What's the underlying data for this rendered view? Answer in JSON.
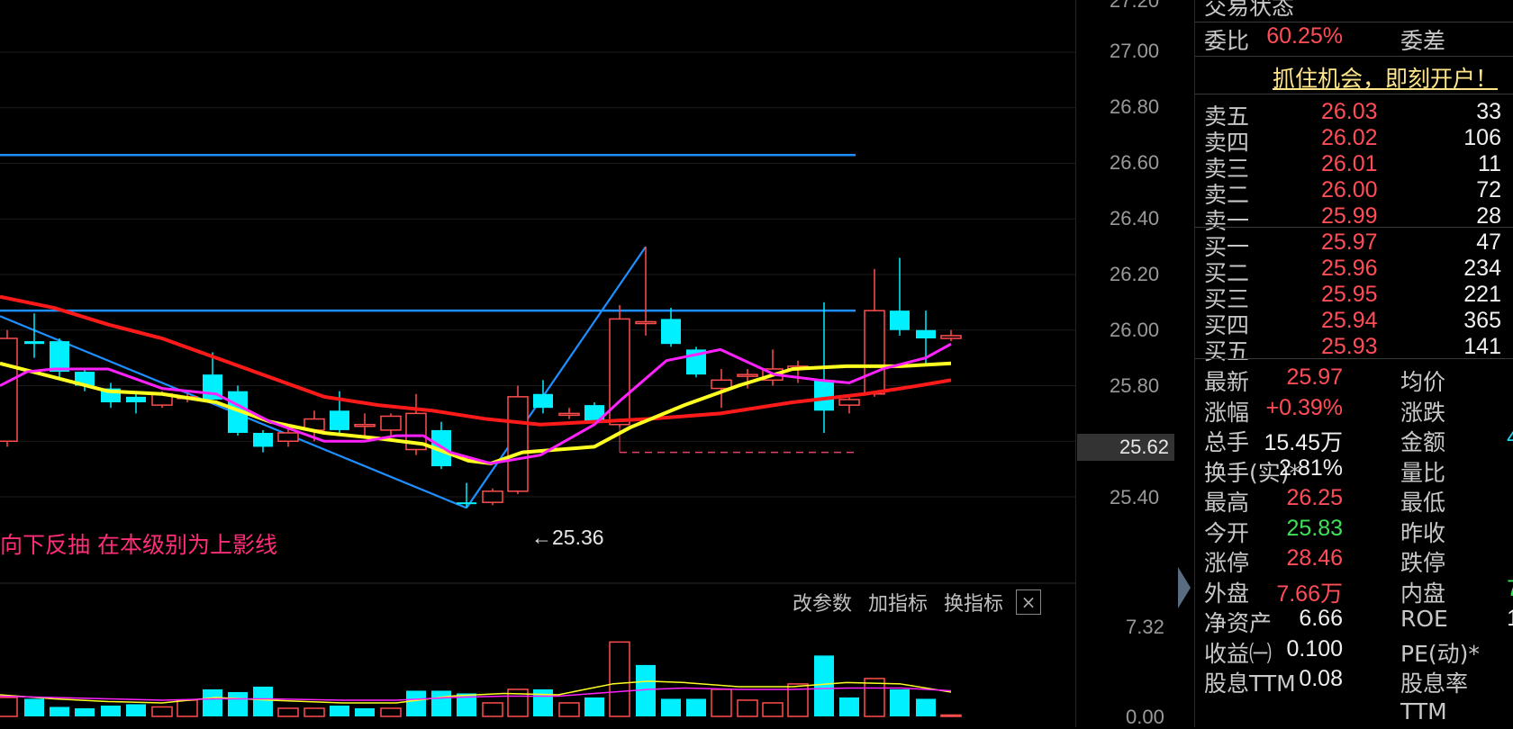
{
  "price_axis": {
    "ticks": [
      "27.00",
      "26.80",
      "26.60",
      "26.40",
      "26.20",
      "26.00",
      "25.80",
      "25.60",
      "25.40"
    ],
    "current_price": "25.62",
    "top_partial": "27.20"
  },
  "annotations": {
    "low_label": "←25.36",
    "note": "向下反抽 在本级别为上影线"
  },
  "toolbar": {
    "modify_params": "改参数",
    "add_indicator": "加指标",
    "change_indicator": "换指标",
    "close": "×"
  },
  "volume_axis": {
    "top": "7.32",
    "bottom": "0.00"
  },
  "panel": {
    "status_header": "交易状态",
    "weibi_label": "委比",
    "weibi_value": "60.25%",
    "weicha_label": "委差",
    "promo": "抓住机会，即刻开户！",
    "sell": [
      {
        "label": "卖五",
        "price": "26.03",
        "qty": "33"
      },
      {
        "label": "卖四",
        "price": "26.02",
        "qty": "106"
      },
      {
        "label": "卖三",
        "price": "26.01",
        "qty": "11"
      },
      {
        "label": "卖二",
        "price": "26.00",
        "qty": "72"
      },
      {
        "label": "卖一",
        "price": "25.99",
        "qty": "28"
      }
    ],
    "buy": [
      {
        "label": "买一",
        "price": "25.97",
        "qty": "47"
      },
      {
        "label": "买二",
        "price": "25.96",
        "qty": "234"
      },
      {
        "label": "买三",
        "price": "25.95",
        "qty": "221"
      },
      {
        "label": "买四",
        "price": "25.94",
        "qty": "365"
      },
      {
        "label": "买五",
        "price": "25.93",
        "qty": "141"
      }
    ],
    "stats": [
      {
        "l1": "最新",
        "v1": "25.97",
        "c1": "red",
        "l2": "均价"
      },
      {
        "l1": "涨幅",
        "v1": "+0.39%",
        "c1": "red",
        "l2": "涨跌"
      },
      {
        "l1": "总手",
        "v1": "15.45万",
        "c1": "white",
        "l2": "金额",
        "v2": "4",
        "c2": "cyan"
      },
      {
        "l1": "换手(实)*",
        "v1": "2.81%",
        "c1": "white",
        "l2": "量比"
      },
      {
        "l1": "最高",
        "v1": "26.25",
        "c1": "red",
        "l2": "最低"
      },
      {
        "l1": "今开",
        "v1": "25.83",
        "c1": "green",
        "l2": "昨收"
      },
      {
        "l1": "涨停",
        "v1": "28.46",
        "c1": "red",
        "l2": "跌停"
      },
      {
        "l1": "外盘",
        "v1": "7.66万",
        "c1": "red",
        "l2": "内盘",
        "v2": "7",
        "c2": "green"
      },
      {
        "l1": "净资产",
        "v1": "6.66",
        "c1": "white",
        "l2": "ROE",
        "v2": "1",
        "c2": "white"
      },
      {
        "l1": "收益㈠",
        "v1": "0.100",
        "c1": "white",
        "l2": "PE(动)*",
        "v2": "(",
        "c2": "white"
      },
      {
        "l1": "股息TTM",
        "v1": "0.08",
        "c1": "white",
        "l2": "股息率TTM"
      }
    ]
  },
  "chart_data": {
    "type": "candlestick",
    "y_range": [
      25.25,
      27.25
    ],
    "low_marker": 25.36,
    "hlines": [
      26.63,
      26.07
    ],
    "candles": [
      {
        "x": 8,
        "o": 25.6,
        "c": 25.97,
        "h": 26.0,
        "l": 25.58,
        "up": true
      },
      {
        "x": 38,
        "o": 25.96,
        "c": 25.95,
        "h": 26.06,
        "l": 25.9,
        "up": false
      },
      {
        "x": 66,
        "o": 25.96,
        "c": 25.85,
        "h": 25.97,
        "l": 25.82,
        "up": false
      },
      {
        "x": 94,
        "o": 25.85,
        "c": 25.8,
        "h": 25.86,
        "l": 25.78,
        "up": false
      },
      {
        "x": 123,
        "o": 25.79,
        "c": 25.74,
        "h": 25.81,
        "l": 25.72,
        "up": false
      },
      {
        "x": 151,
        "o": 25.76,
        "c": 25.74,
        "h": 25.77,
        "l": 25.7,
        "up": false
      },
      {
        "x": 180,
        "o": 25.73,
        "c": 25.77,
        "h": 25.78,
        "l": 25.72,
        "up": true
      },
      {
        "x": 208,
        "o": 25.76,
        "c": 25.76,
        "h": 25.77,
        "l": 25.74,
        "up": true
      },
      {
        "x": 236,
        "o": 25.84,
        "c": 25.75,
        "h": 25.92,
        "l": 25.75,
        "up": false
      },
      {
        "x": 264,
        "o": 25.78,
        "c": 25.63,
        "h": 25.8,
        "l": 25.62,
        "up": false
      },
      {
        "x": 292,
        "o": 25.63,
        "c": 25.58,
        "h": 25.64,
        "l": 25.56,
        "up": false
      },
      {
        "x": 320,
        "o": 25.6,
        "c": 25.63,
        "h": 25.66,
        "l": 25.58,
        "up": true
      },
      {
        "x": 349,
        "o": 25.64,
        "c": 25.68,
        "h": 25.71,
        "l": 25.6,
        "up": true
      },
      {
        "x": 377,
        "o": 25.71,
        "c": 25.64,
        "h": 25.78,
        "l": 25.63,
        "up": false
      },
      {
        "x": 405,
        "o": 25.66,
        "c": 25.66,
        "h": 25.7,
        "l": 25.62,
        "up": true
      },
      {
        "x": 434,
        "o": 25.64,
        "c": 25.69,
        "h": 25.7,
        "l": 25.62,
        "up": true
      },
      {
        "x": 462,
        "o": 25.57,
        "c": 25.7,
        "h": 25.77,
        "l": 25.55,
        "up": true
      },
      {
        "x": 490,
        "o": 25.64,
        "c": 25.51,
        "h": 25.67,
        "l": 25.5,
        "up": false
      },
      {
        "x": 518,
        "o": 25.38,
        "c": 25.38,
        "h": 25.45,
        "l": 25.36,
        "up": false
      },
      {
        "x": 547,
        "o": 25.38,
        "c": 25.42,
        "h": 25.43,
        "l": 25.37,
        "up": true
      },
      {
        "x": 575,
        "o": 25.42,
        "c": 25.76,
        "h": 25.8,
        "l": 25.41,
        "up": true
      },
      {
        "x": 603,
        "o": 25.77,
        "c": 25.72,
        "h": 25.82,
        "l": 25.7,
        "up": false
      },
      {
        "x": 632,
        "o": 25.7,
        "c": 25.7,
        "h": 25.72,
        "l": 25.68,
        "up": true
      },
      {
        "x": 660,
        "o": 25.73,
        "c": 25.67,
        "h": 25.74,
        "l": 25.66,
        "up": false
      },
      {
        "x": 688,
        "o": 25.66,
        "c": 26.04,
        "h": 26.09,
        "l": 25.65,
        "up": true
      },
      {
        "x": 717,
        "o": 26.03,
        "c": 26.03,
        "h": 26.3,
        "l": 25.98,
        "up": true
      },
      {
        "x": 745,
        "o": 26.04,
        "c": 25.95,
        "h": 26.08,
        "l": 25.94,
        "up": false
      },
      {
        "x": 773,
        "o": 25.93,
        "c": 25.84,
        "h": 25.94,
        "l": 25.83,
        "up": false
      },
      {
        "x": 801,
        "o": 25.79,
        "c": 25.82,
        "h": 25.86,
        "l": 25.72,
        "up": true
      },
      {
        "x": 830,
        "o": 25.84,
        "c": 25.84,
        "h": 25.86,
        "l": 25.79,
        "up": true
      },
      {
        "x": 858,
        "o": 25.82,
        "c": 25.86,
        "h": 25.93,
        "l": 25.8,
        "up": true
      },
      {
        "x": 886,
        "o": 25.86,
        "c": 25.87,
        "h": 25.89,
        "l": 25.81,
        "up": true
      },
      {
        "x": 915,
        "o": 25.82,
        "c": 25.71,
        "h": 26.1,
        "l": 25.63,
        "up": false
      },
      {
        "x": 943,
        "o": 25.73,
        "c": 25.75,
        "h": 25.76,
        "l": 25.7,
        "up": true
      },
      {
        "x": 971,
        "o": 25.77,
        "c": 26.07,
        "h": 26.22,
        "l": 25.76,
        "up": true
      },
      {
        "x": 999,
        "o": 26.07,
        "c": 26.0,
        "h": 26.26,
        "l": 25.98,
        "up": false
      },
      {
        "x": 1028,
        "o": 26.0,
        "c": 25.97,
        "h": 26.07,
        "l": 25.87,
        "up": false
      },
      {
        "x": 1056,
        "o": 25.97,
        "c": 25.98,
        "h": 26.0,
        "l": 25.96,
        "up": true
      }
    ],
    "ma_yellow": [
      [
        0,
        25.88
      ],
      [
        60,
        25.83
      ],
      [
        120,
        25.78
      ],
      [
        180,
        25.77
      ],
      [
        240,
        25.74
      ],
      [
        300,
        25.67
      ],
      [
        360,
        25.63
      ],
      [
        420,
        25.61
      ],
      [
        470,
        25.59
      ],
      [
        520,
        25.53
      ],
      [
        545,
        25.52
      ],
      [
        580,
        25.56
      ],
      [
        620,
        25.57
      ],
      [
        660,
        25.58
      ],
      [
        700,
        25.65
      ],
      [
        760,
        25.73
      ],
      [
        820,
        25.8
      ],
      [
        880,
        25.86
      ],
      [
        940,
        25.87
      ],
      [
        1000,
        25.87
      ],
      [
        1056,
        25.88
      ]
    ],
    "ma_red": [
      [
        0,
        26.12
      ],
      [
        60,
        26.08
      ],
      [
        120,
        26.02
      ],
      [
        180,
        25.97
      ],
      [
        240,
        25.9
      ],
      [
        300,
        25.83
      ],
      [
        360,
        25.76
      ],
      [
        420,
        25.73
      ],
      [
        480,
        25.71
      ],
      [
        540,
        25.68
      ],
      [
        600,
        25.66
      ],
      [
        660,
        25.67
      ],
      [
        720,
        25.68
      ],
      [
        800,
        25.7
      ],
      [
        880,
        25.74
      ],
      [
        960,
        25.77
      ],
      [
        1020,
        25.8
      ],
      [
        1056,
        25.82
      ]
    ],
    "ma_magenta": [
      [
        0,
        25.8
      ],
      [
        30,
        25.85
      ],
      [
        60,
        25.86
      ],
      [
        120,
        25.86
      ],
      [
        180,
        25.79
      ],
      [
        240,
        25.77
      ],
      [
        300,
        25.67
      ],
      [
        360,
        25.6
      ],
      [
        405,
        25.6
      ],
      [
        440,
        25.62
      ],
      [
        470,
        25.62
      ],
      [
        500,
        25.56
      ],
      [
        545,
        25.52
      ],
      [
        600,
        25.55
      ],
      [
        660,
        25.66
      ],
      [
        690,
        25.75
      ],
      [
        740,
        25.89
      ],
      [
        800,
        25.93
      ],
      [
        860,
        25.84
      ],
      [
        910,
        25.82
      ],
      [
        943,
        25.81
      ],
      [
        980,
        25.86
      ],
      [
        1028,
        25.9
      ],
      [
        1056,
        25.95
      ]
    ],
    "blue_lines": [
      [
        [
          0,
          26.05
        ],
        [
          518,
          25.36
        ]
      ],
      [
        [
          518,
          25.36
        ],
        [
          717,
          26.3
        ]
      ]
    ],
    "dashed_box": {
      "x1": 688,
      "x2": 886,
      "y": 25.56
    },
    "volume": {
      "max": 7.32,
      "bars": [
        {
          "x": 8,
          "v": 1.4,
          "up": true
        },
        {
          "x": 38,
          "v": 1.3,
          "up": false
        },
        {
          "x": 66,
          "v": 0.7,
          "up": false
        },
        {
          "x": 94,
          "v": 0.6,
          "up": false
        },
        {
          "x": 123,
          "v": 0.8,
          "up": false
        },
        {
          "x": 151,
          "v": 0.9,
          "up": false
        },
        {
          "x": 180,
          "v": 0.7,
          "up": true
        },
        {
          "x": 208,
          "v": 1.2,
          "up": true
        },
        {
          "x": 236,
          "v": 2.0,
          "up": false
        },
        {
          "x": 264,
          "v": 1.8,
          "up": false
        },
        {
          "x": 292,
          "v": 2.2,
          "up": false
        },
        {
          "x": 320,
          "v": 0.6,
          "up": true
        },
        {
          "x": 349,
          "v": 0.6,
          "up": true
        },
        {
          "x": 377,
          "v": 0.8,
          "up": false
        },
        {
          "x": 405,
          "v": 0.6,
          "up": false
        },
        {
          "x": 434,
          "v": 0.6,
          "up": true
        },
        {
          "x": 462,
          "v": 1.9,
          "up": false
        },
        {
          "x": 490,
          "v": 1.9,
          "up": false
        },
        {
          "x": 518,
          "v": 1.7,
          "up": false
        },
        {
          "x": 547,
          "v": 1.0,
          "up": true
        },
        {
          "x": 575,
          "v": 2.0,
          "up": true
        },
        {
          "x": 603,
          "v": 2.0,
          "up": false
        },
        {
          "x": 632,
          "v": 1.0,
          "up": true
        },
        {
          "x": 660,
          "v": 1.4,
          "up": false
        },
        {
          "x": 688,
          "v": 5.5,
          "up": true
        },
        {
          "x": 717,
          "v": 3.8,
          "up": false
        },
        {
          "x": 745,
          "v": 1.3,
          "up": false
        },
        {
          "x": 773,
          "v": 1.3,
          "up": false
        },
        {
          "x": 801,
          "v": 2.0,
          "up": true
        },
        {
          "x": 830,
          "v": 1.2,
          "up": true
        },
        {
          "x": 858,
          "v": 1.0,
          "up": true
        },
        {
          "x": 886,
          "v": 2.4,
          "up": true
        },
        {
          "x": 915,
          "v": 4.5,
          "up": false
        },
        {
          "x": 943,
          "v": 1.4,
          "up": false
        },
        {
          "x": 971,
          "v": 2.8,
          "up": true
        },
        {
          "x": 999,
          "v": 2.0,
          "up": false
        },
        {
          "x": 1028,
          "v": 1.3,
          "up": false
        },
        {
          "x": 1056,
          "v": 0.1,
          "up": true
        }
      ],
      "ma_yellow": [
        [
          0,
          1.6
        ],
        [
          60,
          1.3
        ],
        [
          120,
          1.1
        ],
        [
          180,
          1.0
        ],
        [
          240,
          1.4
        ],
        [
          300,
          1.2
        ],
        [
          380,
          1.0
        ],
        [
          440,
          1.0
        ],
        [
          500,
          1.5
        ],
        [
          560,
          1.7
        ],
        [
          620,
          1.6
        ],
        [
          680,
          2.4
        ],
        [
          720,
          2.6
        ],
        [
          760,
          2.5
        ],
        [
          820,
          2.2
        ],
        [
          880,
          2.2
        ],
        [
          940,
          2.5
        ],
        [
          1000,
          2.4
        ],
        [
          1056,
          1.8
        ]
      ],
      "ma_magenta": [
        [
          0,
          1.5
        ],
        [
          60,
          1.4
        ],
        [
          120,
          1.3
        ],
        [
          180,
          1.2
        ],
        [
          240,
          1.3
        ],
        [
          300,
          1.3
        ],
        [
          380,
          1.2
        ],
        [
          440,
          1.2
        ],
        [
          500,
          1.4
        ],
        [
          560,
          1.5
        ],
        [
          620,
          1.5
        ],
        [
          680,
          1.8
        ],
        [
          720,
          2.0
        ],
        [
          760,
          2.1
        ],
        [
          820,
          2.0
        ],
        [
          880,
          2.0
        ],
        [
          940,
          2.1
        ],
        [
          1000,
          2.1
        ],
        [
          1056,
          1.9
        ]
      ]
    }
  }
}
